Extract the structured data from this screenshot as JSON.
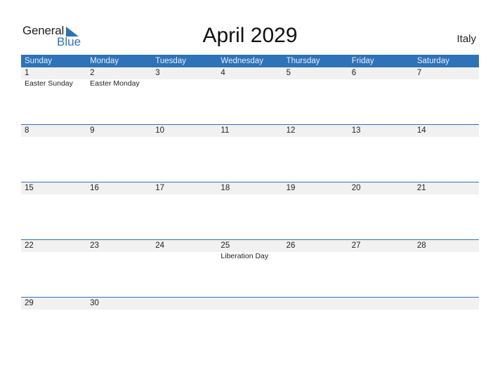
{
  "logo": {
    "general": "General",
    "blue": "Blue"
  },
  "title": "April 2029",
  "country": "Italy",
  "colors": {
    "accent": "#2e72b8",
    "strip": "#f1f1f1"
  },
  "weekdays": [
    "Sunday",
    "Monday",
    "Tuesday",
    "Wednesday",
    "Thursday",
    "Friday",
    "Saturday"
  ],
  "weeks": [
    [
      {
        "day": "1",
        "event": "Easter Sunday"
      },
      {
        "day": "2",
        "event": "Easter Monday"
      },
      {
        "day": "3",
        "event": ""
      },
      {
        "day": "4",
        "event": ""
      },
      {
        "day": "5",
        "event": ""
      },
      {
        "day": "6",
        "event": ""
      },
      {
        "day": "7",
        "event": ""
      }
    ],
    [
      {
        "day": "8",
        "event": ""
      },
      {
        "day": "9",
        "event": ""
      },
      {
        "day": "10",
        "event": ""
      },
      {
        "day": "11",
        "event": ""
      },
      {
        "day": "12",
        "event": ""
      },
      {
        "day": "13",
        "event": ""
      },
      {
        "day": "14",
        "event": ""
      }
    ],
    [
      {
        "day": "15",
        "event": ""
      },
      {
        "day": "16",
        "event": ""
      },
      {
        "day": "17",
        "event": ""
      },
      {
        "day": "18",
        "event": ""
      },
      {
        "day": "19",
        "event": ""
      },
      {
        "day": "20",
        "event": ""
      },
      {
        "day": "21",
        "event": ""
      }
    ],
    [
      {
        "day": "22",
        "event": ""
      },
      {
        "day": "23",
        "event": ""
      },
      {
        "day": "24",
        "event": ""
      },
      {
        "day": "25",
        "event": "Liberation Day"
      },
      {
        "day": "26",
        "event": ""
      },
      {
        "day": "27",
        "event": ""
      },
      {
        "day": "28",
        "event": ""
      }
    ],
    [
      {
        "day": "29",
        "event": ""
      },
      {
        "day": "30",
        "event": ""
      },
      {
        "day": "",
        "event": ""
      },
      {
        "day": "",
        "event": ""
      },
      {
        "day": "",
        "event": ""
      },
      {
        "day": "",
        "event": ""
      },
      {
        "day": "",
        "event": ""
      }
    ]
  ]
}
